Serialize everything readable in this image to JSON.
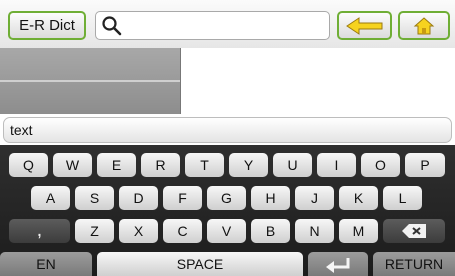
{
  "toolbar": {
    "dict_label": "E-R Dict",
    "search_value": "",
    "search_icon": "search-icon",
    "back_icon": "arrow-left-icon",
    "home_icon": "home-icon"
  },
  "word_input": {
    "value": "text"
  },
  "keyboard": {
    "row1": [
      "Q",
      "W",
      "E",
      "R",
      "T",
      "Y",
      "U",
      "I",
      "O",
      "P"
    ],
    "row2": [
      "A",
      "S",
      "D",
      "F",
      "G",
      "H",
      "J",
      "K",
      "L"
    ],
    "row3_keys": [
      ",",
      "Z",
      "X",
      "C",
      "V",
      "B",
      "N",
      "M"
    ],
    "backspace_icon": "backspace-icon",
    "row4": {
      "lang": "EN",
      "space": "SPACE",
      "enter_icon": "enter-icon",
      "return": "RETURN"
    }
  },
  "colors": {
    "accent_green": "#6fae35",
    "icon_yellow": "#f6d31f"
  }
}
